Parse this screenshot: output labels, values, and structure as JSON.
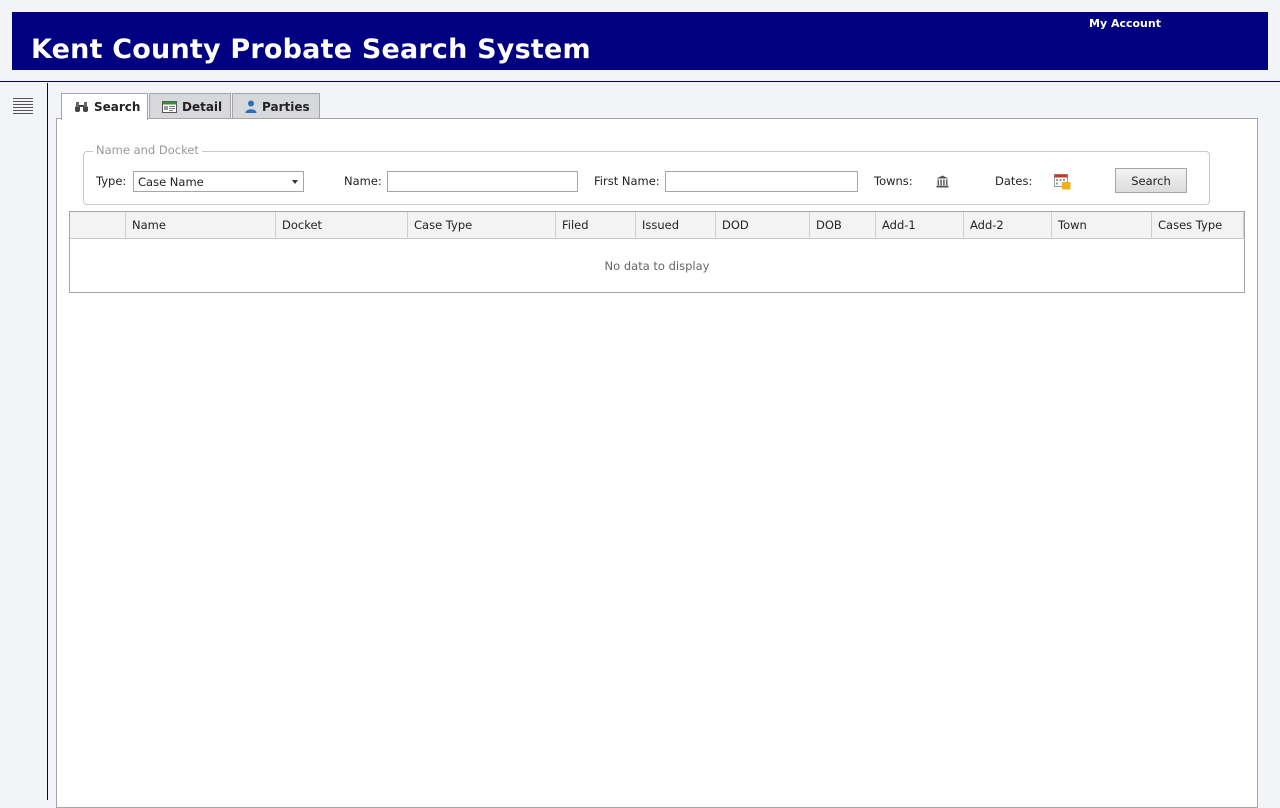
{
  "header": {
    "title": "Kent County Probate Search System",
    "account_link": "My Account",
    "brand_color": "#000080"
  },
  "sidebar": {
    "menu_icon": "list-icon"
  },
  "tabs": [
    {
      "label": "Search",
      "icon": "binoculars-icon",
      "active": true
    },
    {
      "label": "Detail",
      "icon": "detail-card-icon",
      "active": false
    },
    {
      "label": "Parties",
      "icon": "person-icon",
      "active": false
    }
  ],
  "search_form": {
    "legend": "Name and Docket",
    "type_label": "Type:",
    "type_value": "Case Name",
    "name_label": "Name:",
    "name_value": "",
    "first_name_label": "First Name:",
    "first_name_value": "",
    "towns_label": "Towns:",
    "towns_icon": "bank-building-icon",
    "dates_label": "Dates:",
    "dates_icon": "calendar-icon",
    "search_button": "Search"
  },
  "results_grid": {
    "columns": [
      "",
      "Name",
      "Docket",
      "Case Type",
      "Filed",
      "Issued",
      "DOD",
      "DOB",
      "Add-1",
      "Add-2",
      "Town",
      "Cases Type"
    ],
    "rows": [],
    "empty_message": "No data to display"
  }
}
